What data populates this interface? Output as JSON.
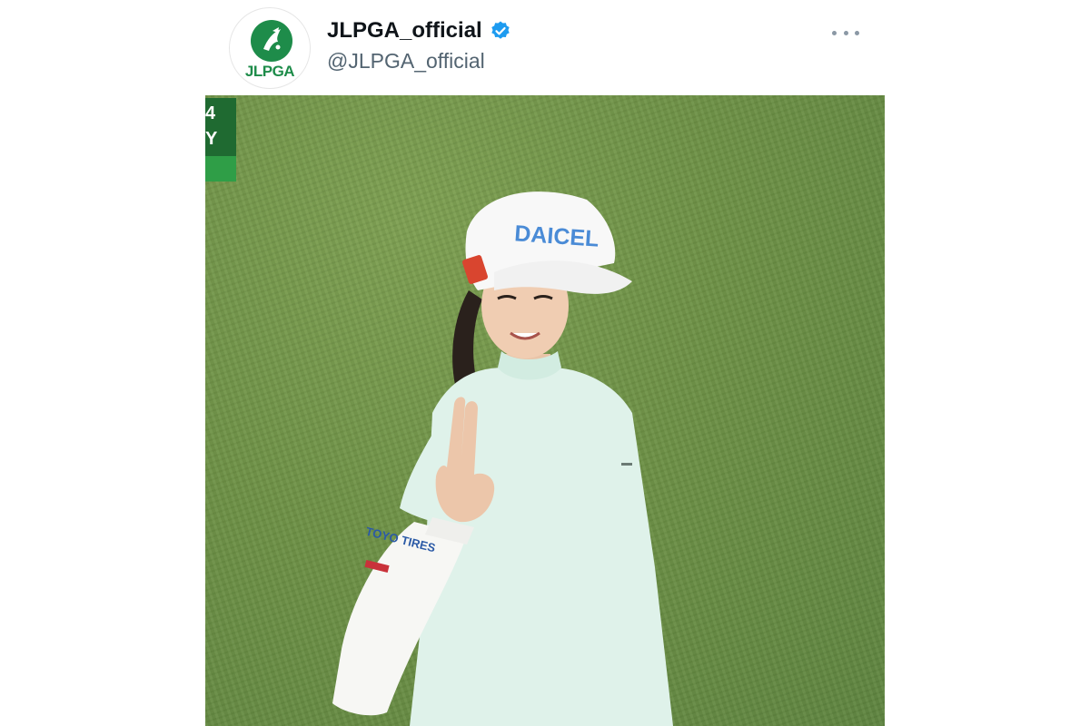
{
  "post": {
    "display_name": "JLPGA_official",
    "handle": "@JLPGA_official",
    "avatar_logo_text": "JLPGA",
    "verified": true,
    "verified_color": "#1d9bf0",
    "more_icon": "more-horizontal-icon"
  },
  "media": {
    "score_overlay": [
      "4",
      "Y"
    ],
    "cap_logo": "DAICEL",
    "sleeve_logo": "TOYO TIRES",
    "colors": {
      "grass": "#6e9246",
      "shirt": "#dff2ea",
      "overlay_green": "#1f6a31",
      "brand_green": "#1e8c4a"
    }
  }
}
